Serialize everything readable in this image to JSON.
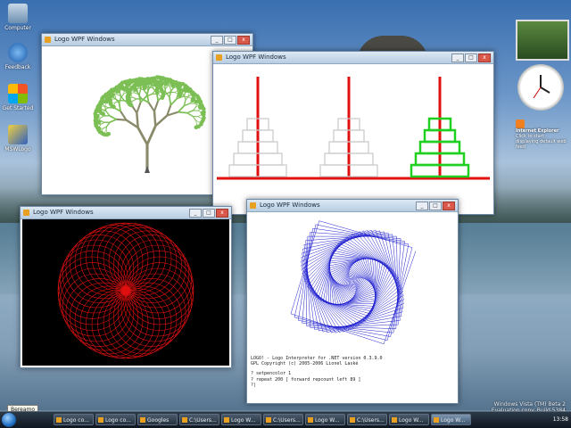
{
  "desktop": {
    "icons": [
      {
        "label": "Computer"
      },
      {
        "label": "Feedback"
      },
      {
        "label": "Get Started"
      },
      {
        "label": "MSWLogo"
      }
    ]
  },
  "windows": {
    "tree": {
      "title": "Logo WPF Windows"
    },
    "hanoi": {
      "title": "Logo WPF Windows"
    },
    "spiro": {
      "title": "Logo WPF Windows"
    },
    "spiral": {
      "title": "Logo WPF Windows"
    }
  },
  "console": {
    "line1": "LOGO! - Logo Interpreter for .NET version 0.3.9.0",
    "line2": "GPL Copyright (c) 2005-2006 Lionel Laské",
    "line3": "? setpencolor 1",
    "line4": "? repeat 200 [ forward repcount left 89 ]",
    "line5": "?|"
  },
  "sidebar": {
    "rss_title": "Internet Explorer",
    "rss_text": "Click to start displaying default web feed"
  },
  "taskbar": {
    "tooltip": "Bereamo",
    "buttons": [
      "Logo co...",
      "Logo co...",
      "Googles",
      "C:\\Users...",
      "Logo W...",
      "C:\\Users...",
      "Logo W...",
      "C:\\Users...",
      "Logo W...",
      "Logo W..."
    ],
    "time": "13:58"
  },
  "watermark": {
    "line1": "Windows Vista (TM) Beta 2",
    "line2": "Evaluation copy. Build 5384"
  },
  "colors": {
    "tree": "#7cbf55",
    "hanoi_pole": "#e01010",
    "hanoi_disk_grey": "#c8c8c8",
    "hanoi_disk_green": "#20d020",
    "spiro": "#e01010",
    "spiral": "#2020d0"
  }
}
